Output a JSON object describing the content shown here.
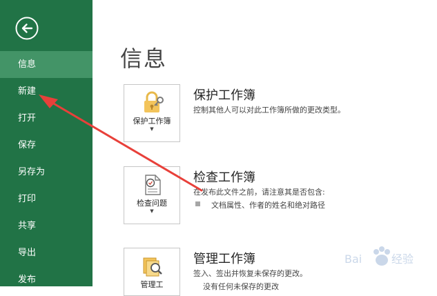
{
  "sidebar": {
    "items": [
      {
        "label": "信息",
        "active": true
      },
      {
        "label": "新建"
      },
      {
        "label": "打开"
      },
      {
        "label": "保存"
      },
      {
        "label": "另存为"
      },
      {
        "label": "打印"
      },
      {
        "label": "共享"
      },
      {
        "label": "导出"
      },
      {
        "label": "发布"
      }
    ]
  },
  "main": {
    "title": "信息",
    "sections": [
      {
        "tile_label": "保护工作簿",
        "title": "保护工作簿",
        "desc": "控制其他人可以对此工作簿所做的更改类型。"
      },
      {
        "tile_label": "检查问题",
        "title": "检查工作簿",
        "desc": "在发布此文件之前，请注意其是否包含:",
        "bullet": "文档属性、作者的姓名和绝对路径"
      },
      {
        "tile_label": "管理工",
        "title": "管理工作簿",
        "desc": "签入、签出并恢复未保存的更改。",
        "bullet_partial": "没有任何未保存的更改"
      }
    ]
  },
  "colors": {
    "sidebar": "#217346",
    "sidebar_active": "#439467",
    "arrow": "#e8403a"
  },
  "watermark": {
    "logo": "baidu-logo",
    "text": "经验"
  }
}
